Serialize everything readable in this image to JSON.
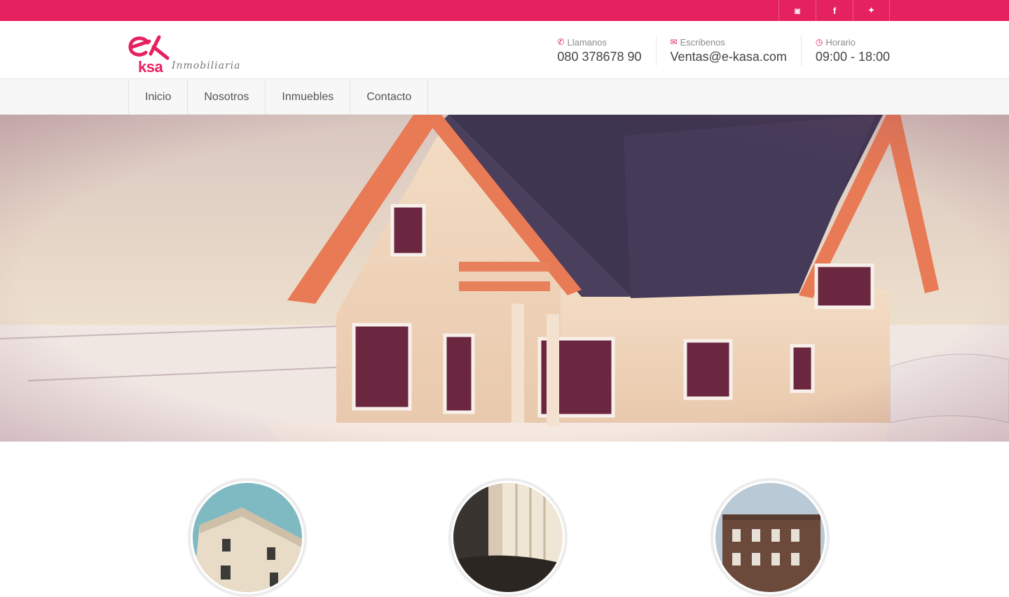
{
  "social": [
    {
      "icon": "instagram-icon",
      "glyph": "◙"
    },
    {
      "icon": "facebook-icon",
      "glyph": "f"
    },
    {
      "icon": "twitter-icon",
      "glyph": "✦"
    }
  ],
  "logo": {
    "ksa": "ksa",
    "subtitle": "Inmobiliaria"
  },
  "contacts": {
    "phone": {
      "label": "Llamanos",
      "value": "080 378678 90",
      "icon": "✆"
    },
    "email": {
      "label": "Escribenos",
      "value": "Ventas@e-kasa.com",
      "icon": "✉"
    },
    "hours": {
      "label": "Horario",
      "value": "09:00 - 18:00",
      "icon": "◷"
    }
  },
  "nav": {
    "items": [
      "Inicio",
      "Nosotros",
      "Inmuebles",
      "Contacto"
    ]
  },
  "colors": {
    "accent": "#e6215f"
  }
}
